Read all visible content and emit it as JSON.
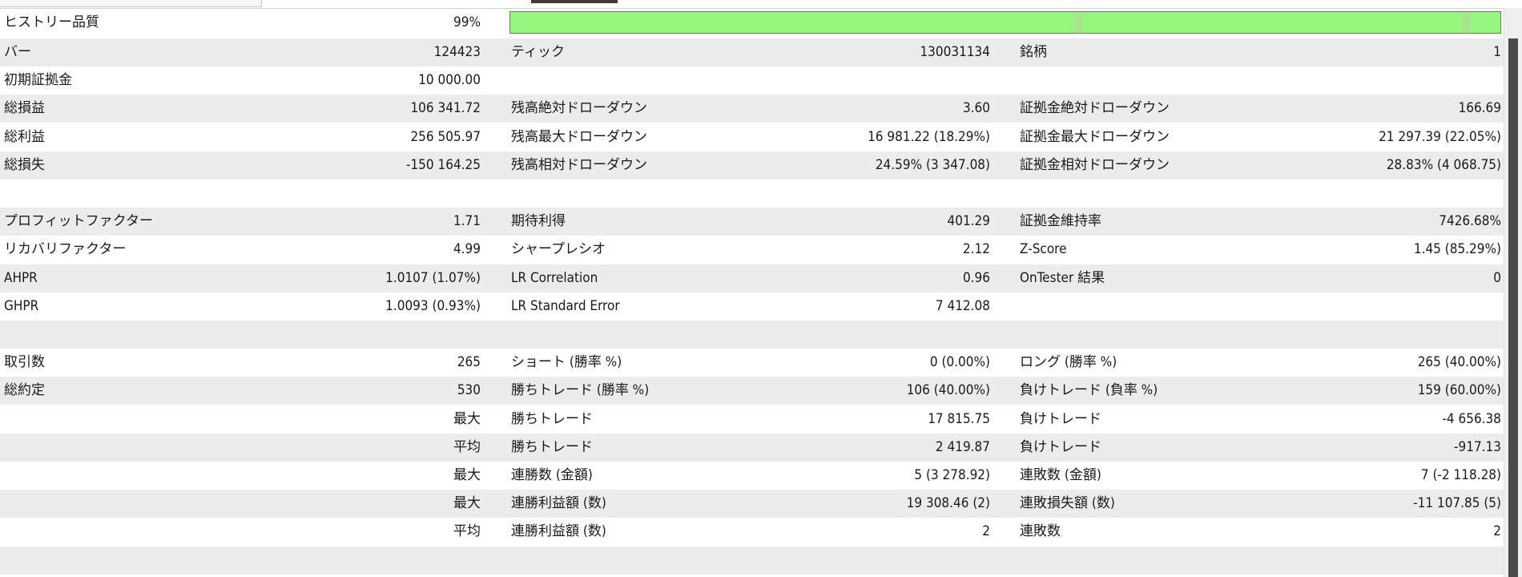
{
  "header": {
    "history_quality_label": "ヒストリー品質",
    "history_quality_value": "99%",
    "history_quality_fraction": 0.99
  },
  "rows": [
    {
      "l1": "バー",
      "v1": "124423",
      "l2": "ティック",
      "v2": "130031134",
      "l3": "銘柄",
      "v3": "1"
    },
    {
      "l1": "初期証拠金",
      "v1": "10 000.00",
      "l2": "",
      "v2": "",
      "l3": "",
      "v3": ""
    },
    {
      "l1": "総損益",
      "v1": "106 341.72",
      "l2": "残高絶対ドローダウン",
      "v2": "3.60",
      "l3": "証拠金絶対ドローダウン",
      "v3": "166.69"
    },
    {
      "l1": "総利益",
      "v1": "256 505.97",
      "l2": "残高最大ドローダウン",
      "v2": "16 981.22 (18.29%)",
      "l3": "証拠金最大ドローダウン",
      "v3": "21 297.39 (22.05%)"
    },
    {
      "l1": "総損失",
      "v1": "-150 164.25",
      "l2": "残高相対ドローダウン",
      "v2": "24.59% (3 347.08)",
      "l3": "証拠金相対ドローダウン",
      "v3": "28.83% (4 068.75)"
    },
    {
      "l1": "",
      "v1": "",
      "l2": "",
      "v2": "",
      "l3": "",
      "v3": ""
    },
    {
      "l1": "プロフィットファクター",
      "v1": "1.71",
      "l2": "期待利得",
      "v2": "401.29",
      "l3": "証拠金維持率",
      "v3": "7426.68%"
    },
    {
      "l1": "リカバリファクター",
      "v1": "4.99",
      "l2": "シャープレシオ",
      "v2": "2.12",
      "l3": "Z-Score",
      "v3": "1.45 (85.29%)"
    },
    {
      "l1": "AHPR",
      "v1": "1.0107 (1.07%)",
      "l2": "LR Correlation",
      "v2": "0.96",
      "l3": "OnTester 結果",
      "v3": "0"
    },
    {
      "l1": "GHPR",
      "v1": "1.0093 (0.93%)",
      "l2": "LR Standard Error",
      "v2": "7 412.08",
      "l3": "",
      "v3": ""
    },
    {
      "l1": "",
      "v1": "",
      "l2": "",
      "v2": "",
      "l3": "",
      "v3": ""
    },
    {
      "l1": "取引数",
      "v1": "265",
      "l2": "ショート (勝率 %)",
      "v2": "0 (0.00%)",
      "l3": "ロング (勝率 %)",
      "v3": "265 (40.00%)"
    },
    {
      "l1": "総約定",
      "v1": "530",
      "l2": "勝ちトレード (勝率 %)",
      "v2": "106 (40.00%)",
      "l3": "負けトレード (負率 %)",
      "v3": "159 (60.00%)"
    },
    {
      "l1": "",
      "v1": "最大",
      "l2": "勝ちトレード",
      "v2": "17 815.75",
      "l3": "負けトレード",
      "v3": "-4 656.38"
    },
    {
      "l1": "",
      "v1": "平均",
      "l2": "勝ちトレード",
      "v2": "2 419.87",
      "l3": "負けトレード",
      "v3": "-917.13"
    },
    {
      "l1": "",
      "v1": "最大",
      "l2": "連勝数 (金額)",
      "v2": "5 (3 278.92)",
      "l3": "連敗数 (金額)",
      "v3": "7 (-2 118.28)"
    },
    {
      "l1": "",
      "v1": "最大",
      "l2": "連勝利益額 (数)",
      "v2": "19 308.46 (2)",
      "l3": "連敗損失額 (数)",
      "v3": "-11 107.85 (5)"
    },
    {
      "l1": "",
      "v1": "平均",
      "l2": "連勝利益額 (数)",
      "v2": "2",
      "l3": "連敗数",
      "v3": "2"
    },
    {
      "l1": "",
      "v1": "",
      "l2": "",
      "v2": "",
      "l3": "",
      "v3": ""
    }
  ],
  "colors": {
    "quality_bar": "#95f57d",
    "row_alt": "#ececec",
    "row_plain": "#ffffff"
  }
}
